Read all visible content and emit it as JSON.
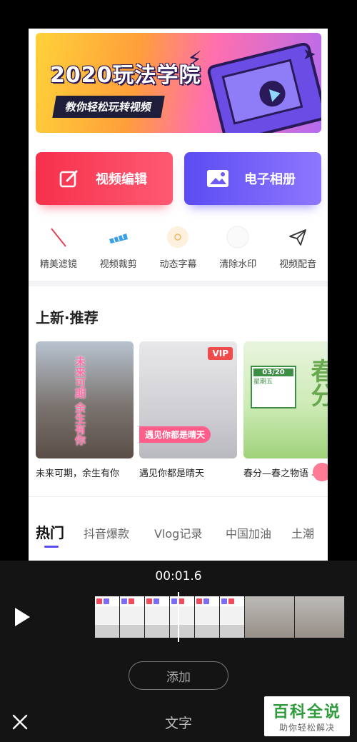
{
  "banner": {
    "title": "2020玩法学院",
    "subtitle": "教你轻松玩转视频"
  },
  "actions": {
    "video_edit": "视频编辑",
    "album": "电子相册"
  },
  "tools": [
    {
      "label": "精美滤镜",
      "icon": "filter-icon"
    },
    {
      "label": "视频裁剪",
      "icon": "crop-icon"
    },
    {
      "label": "动态字幕",
      "icon": "subtitle-icon"
    },
    {
      "label": "清除水印",
      "icon": "eraser-icon"
    },
    {
      "label": "视频配音",
      "icon": "send-icon"
    }
  ],
  "section": {
    "title": "上新·推荐"
  },
  "cards": [
    {
      "caption": "未来可期，余生有你",
      "overlay": "未来可期 余生有你"
    },
    {
      "caption": "遇见你都是晴天",
      "overlay": "遇见你都是晴天",
      "badge": "VIP"
    },
    {
      "caption": "春分—春之物语 鸟语",
      "overlay": "春分",
      "date": "03/20",
      "weekday": "星期五"
    }
  ],
  "categories": [
    "热门",
    "抖音爆款",
    "Vlog记录",
    "中国加油",
    "土潮"
  ],
  "editor": {
    "time": "00:01.6",
    "add_label": "添加",
    "title": "文字"
  },
  "watermark": {
    "line1": "百科全说",
    "line2": "助你轻松解决"
  },
  "colors": {
    "accent_red": "#f6304c",
    "accent_purple": "#5b4cf2",
    "editor_bg": "#141414"
  }
}
